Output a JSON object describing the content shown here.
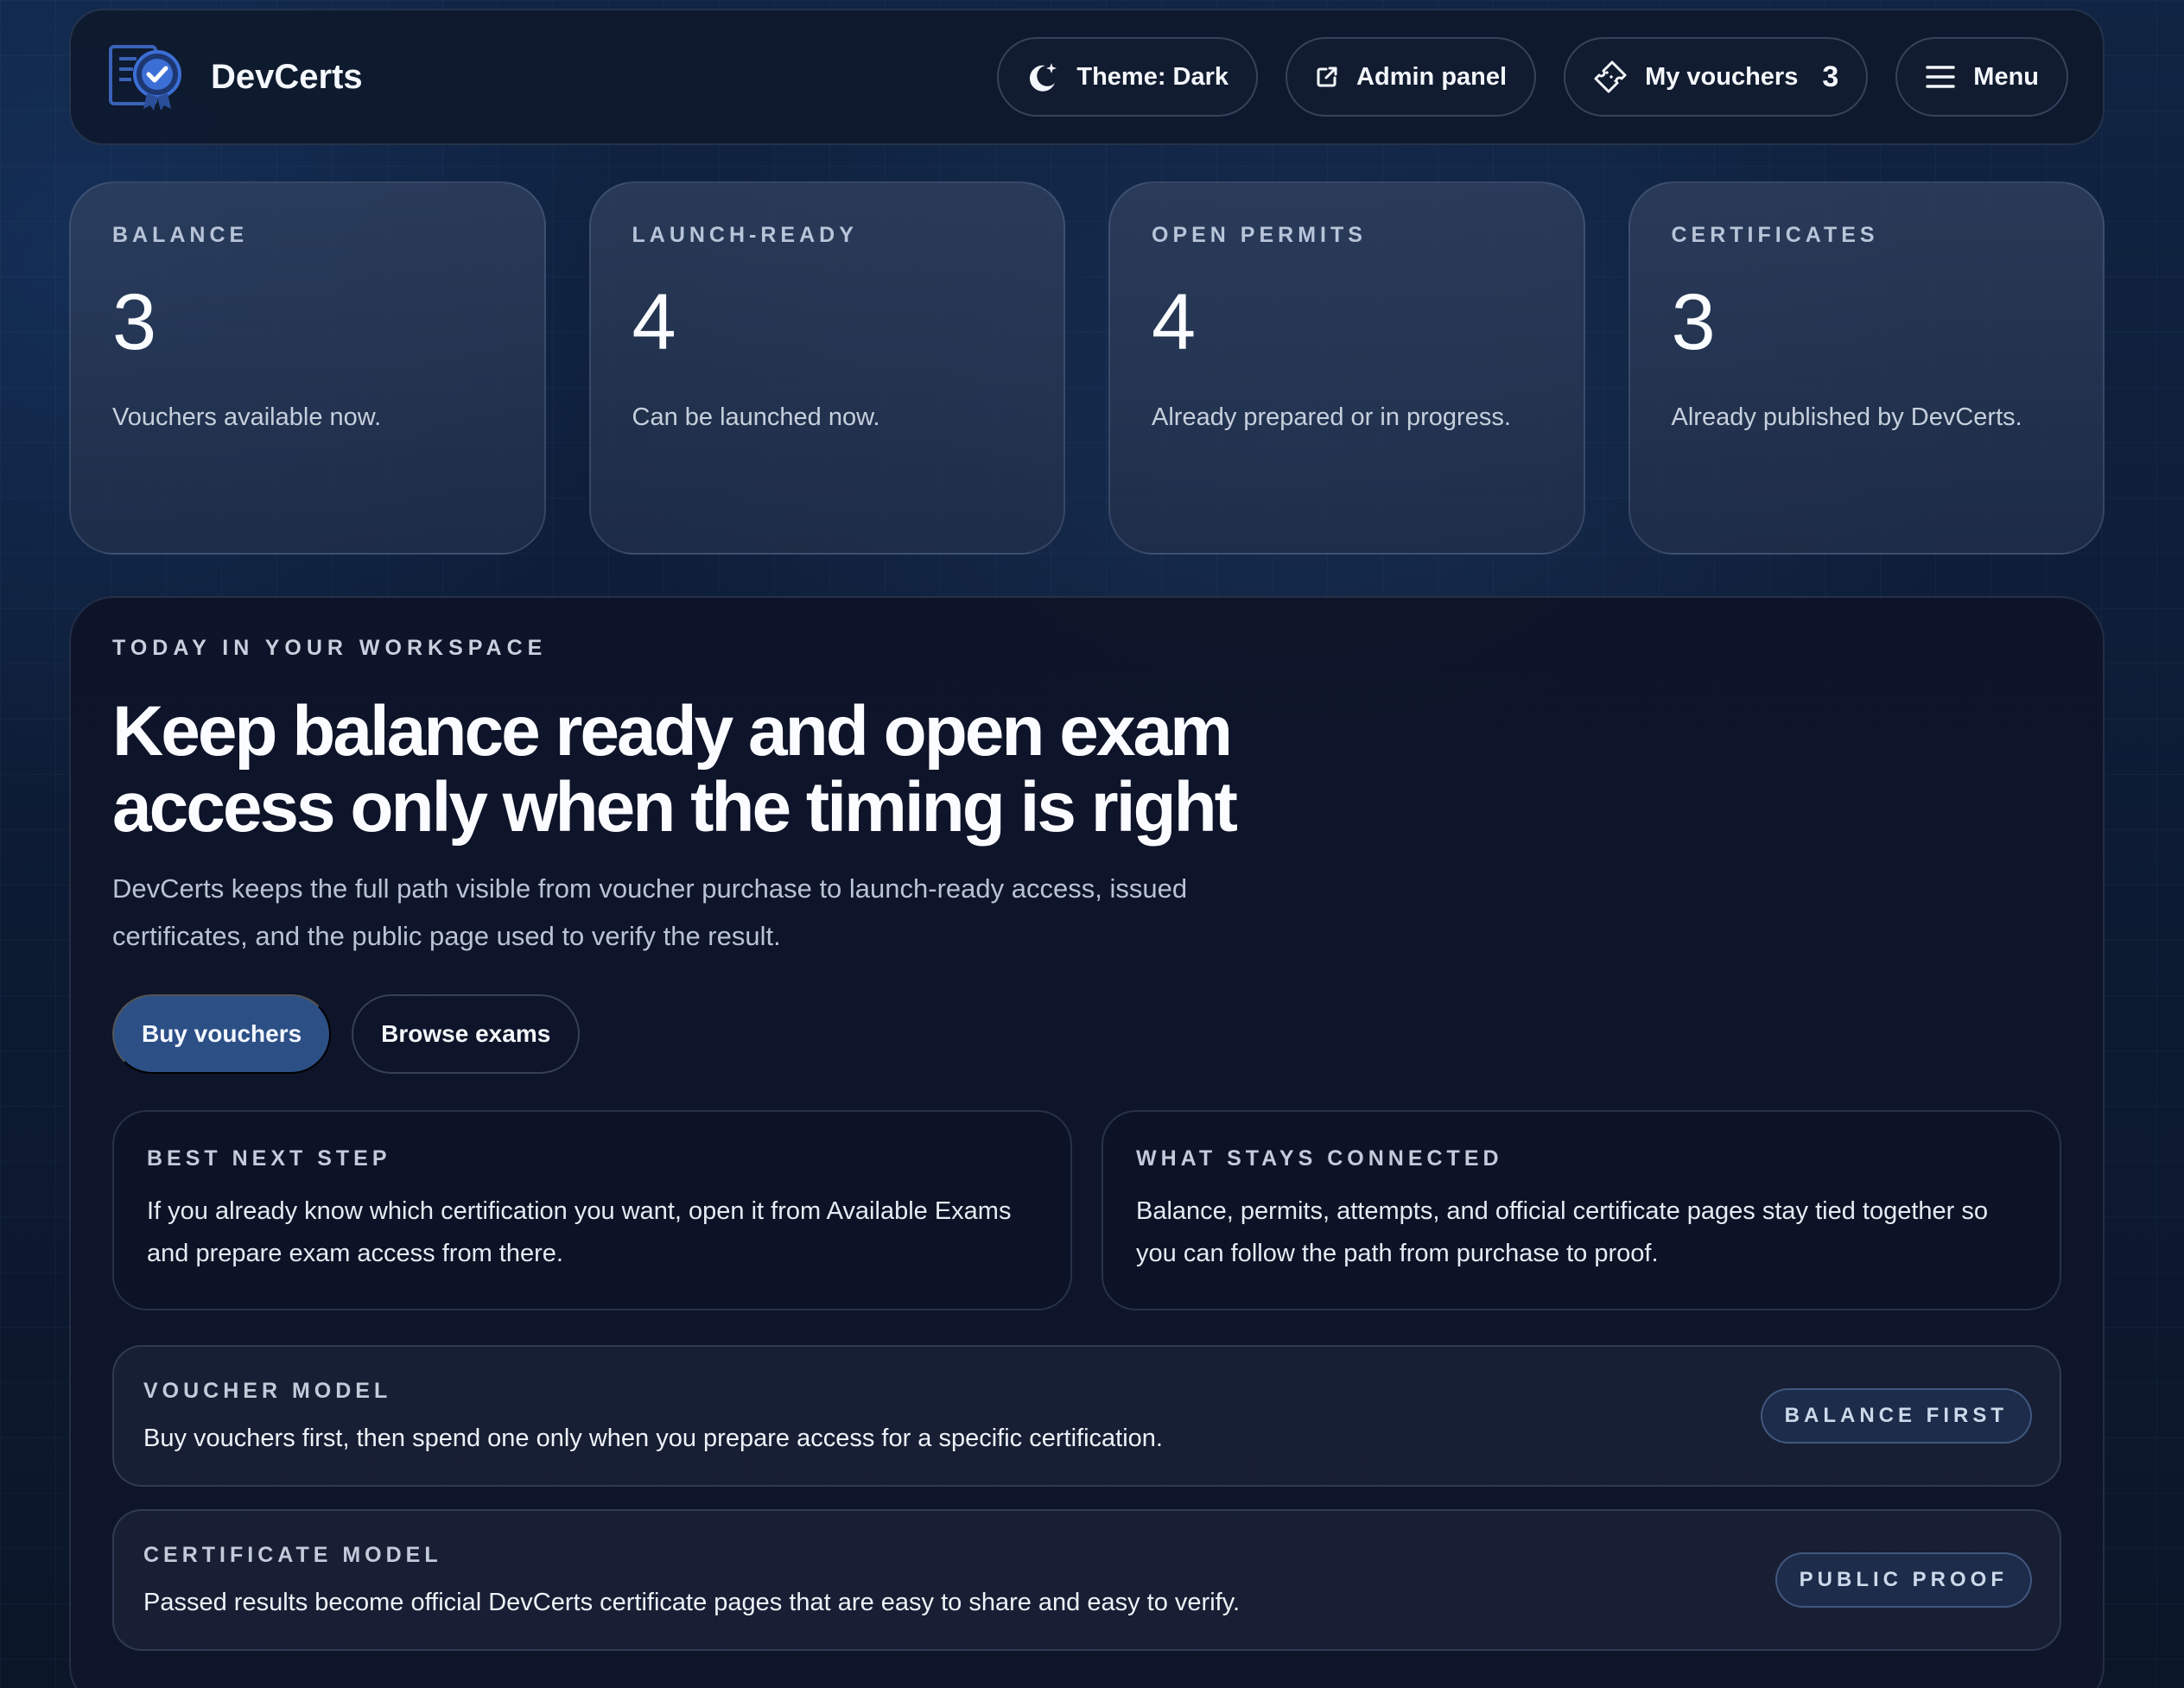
{
  "header": {
    "brand": "DevCerts",
    "theme_label": "Theme: Dark",
    "admin_label": "Admin panel",
    "vouchers_label": "My vouchers",
    "vouchers_count": "3",
    "menu_label": "Menu"
  },
  "stats": [
    {
      "label": "BALANCE",
      "value": "3",
      "desc": "Vouchers available now."
    },
    {
      "label": "LAUNCH-READY",
      "value": "4",
      "desc": "Can be launched now."
    },
    {
      "label": "OPEN PERMITS",
      "value": "4",
      "desc": "Already prepared or in progress."
    },
    {
      "label": "CERTIFICATES",
      "value": "3",
      "desc": "Already published by DevCerts."
    }
  ],
  "hero": {
    "eyebrow": "TODAY IN YOUR WORKSPACE",
    "title": "Keep balance ready and open exam access only when the timing is right",
    "description": "DevCerts keeps the full path visible from voucher purchase to launch-ready access, issued certificates, and the public page used to verify the result.",
    "primary_label": "Buy vouchers",
    "secondary_label": "Browse exams"
  },
  "info": [
    {
      "label": "BEST NEXT STEP",
      "text": "If you already know which certification you want, open it from Available Exams and prepare exam access from there."
    },
    {
      "label": "WHAT STAYS CONNECTED",
      "text": "Balance, permits, attempts, and official certificate pages stay tied together so you can follow the path from purchase to proof."
    }
  ],
  "models": [
    {
      "label": "VOUCHER MODEL",
      "text": "Buy vouchers first, then spend one only when you prepare access for a specific certification.",
      "badge": "BALANCE FIRST"
    },
    {
      "label": "CERTIFICATE MODEL",
      "text": "Passed results become official DevCerts certificate pages that are easy to share and easy to verify.",
      "badge": "PUBLIC PROOF"
    }
  ],
  "colors": {
    "background": "#0d1b33",
    "primary_button": "#2c4f86",
    "logo_accent": "#3c6fd6"
  },
  "icons": {
    "logo": "certificate-badge-icon",
    "theme": "moon-sparkle-icon",
    "admin": "external-link-icon",
    "vouchers": "ticket-icon",
    "menu": "hamburger-icon"
  }
}
